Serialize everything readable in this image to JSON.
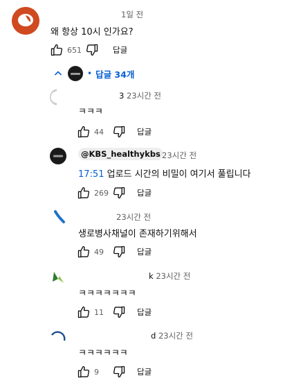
{
  "comment": {
    "time": "1일 전",
    "text": "왜 항상 10시 인가요?",
    "likes": "651",
    "reply_label": "답글",
    "replies_toggle": {
      "bullet": "•",
      "label": "답글 34개"
    }
  },
  "replies": [
    {
      "handle_tail": "3",
      "time": "23시간 전",
      "text": "ㅋㅋㅋ",
      "likes": "44",
      "reply_label": "답글"
    },
    {
      "handle": "@KBS_healthykbs",
      "time": "23시간 전",
      "timestamp_link": "17:51",
      "text": "업로드 시간의 비밀이 여기서 풀립니다",
      "likes": "269",
      "reply_label": "답글"
    },
    {
      "time": "23시간 전",
      "text": "생로병사채널이 존재하기위해서",
      "likes": "49",
      "reply_label": "답글"
    },
    {
      "handle_tail": "k",
      "time": "23시간 전",
      "text": "ㅋㅋㅋㅋㅋㅋㅋ",
      "likes": "11",
      "reply_label": "답글"
    },
    {
      "handle_tail": "d",
      "time": "23시간 전",
      "text": "ㅋㅋㅋㅋㅋㅋ",
      "likes": "9",
      "reply_label": "답글"
    }
  ],
  "colors": {
    "link": "#065fd4",
    "meta": "#606060",
    "avatar_main": "#d4421e"
  },
  "icons": [
    "thumbs-up-icon",
    "thumbs-down-icon",
    "chevron-up-icon"
  ]
}
